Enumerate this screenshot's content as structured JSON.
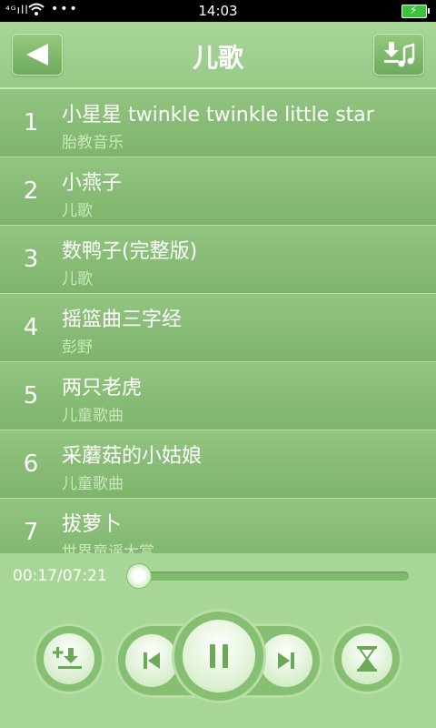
{
  "status_bar": {
    "signal": "⁴ᴳıll",
    "time": "14:03"
  },
  "header": {
    "title": "儿歌",
    "back_icon": "back-arrow-icon",
    "download_icon": "download-music-icon"
  },
  "playlist": [
    {
      "num": "1",
      "name": "小星星 twinkle twinkle little star",
      "artist": "胎教音乐"
    },
    {
      "num": "2",
      "name": "小燕子",
      "artist": "儿歌"
    },
    {
      "num": "3",
      "name": "数鸭子(完整版)",
      "artist": "儿歌"
    },
    {
      "num": "4",
      "name": "摇篮曲三字经",
      "artist": "彭野"
    },
    {
      "num": "5",
      "name": "两只老虎",
      "artist": "儿童歌曲"
    },
    {
      "num": "6",
      "name": "采蘑菇的小姑娘",
      "artist": "儿童歌曲"
    },
    {
      "num": "7",
      "name": "拔萝卜",
      "artist": "世界童谣大赏"
    }
  ],
  "player": {
    "time_readout": "00:17/07:21",
    "progress_fraction": 0.0385
  },
  "colors": {
    "accent": "#9fce8f",
    "row": "#86bb74"
  }
}
